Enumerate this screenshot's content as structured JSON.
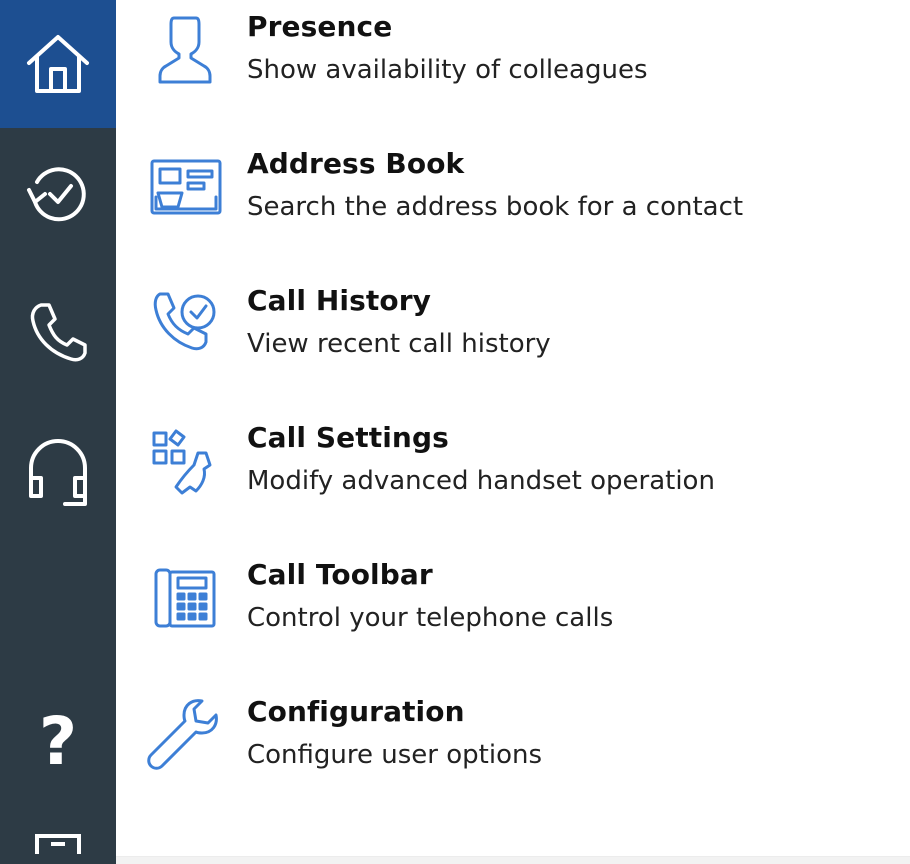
{
  "nav": {
    "items": [
      {
        "icon": "home-icon",
        "active": true
      },
      {
        "icon": "history-icon",
        "active": false
      },
      {
        "icon": "phone-icon",
        "active": false
      },
      {
        "icon": "headset-icon",
        "active": false
      },
      {
        "icon": "help-icon",
        "label": "?",
        "active": false
      },
      {
        "icon": "screen-icon",
        "active": false
      }
    ]
  },
  "menu": {
    "items": [
      {
        "icon": "person-icon",
        "title": "Presence",
        "desc": "Show availability of colleagues"
      },
      {
        "icon": "contact-card-icon",
        "title": "Address Book",
        "desc": "Search the address book for a contact"
      },
      {
        "icon": "call-history-icon",
        "title": "Call History",
        "desc": "View recent call history"
      },
      {
        "icon": "call-settings-icon",
        "title": "Call Settings",
        "desc": "Modify advanced handset operation"
      },
      {
        "icon": "desk-phone-icon",
        "title": "Call Toolbar",
        "desc": "Control your telephone calls"
      },
      {
        "icon": "wrench-icon",
        "title": "Configuration",
        "desc": "Configure user options"
      }
    ]
  },
  "colors": {
    "rail": "#2d3b45",
    "rail_active": "#1d4f91",
    "icon_blue": "#3d7fd6"
  }
}
